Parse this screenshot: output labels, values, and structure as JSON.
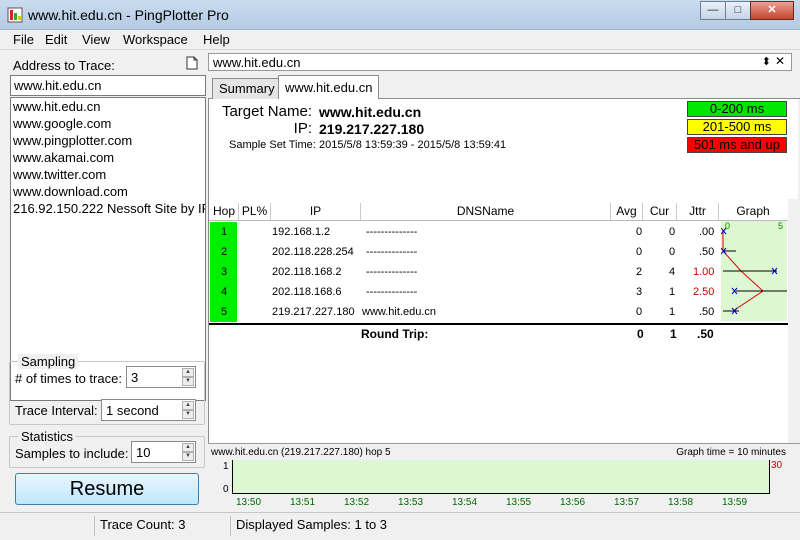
{
  "window": {
    "title": "www.hit.edu.cn - PingPlotter Pro",
    "min_symbol": "—",
    "max_symbol": "□",
    "close_symbol": "✕"
  },
  "menu": [
    "File",
    "Edit",
    "View",
    "Workspace",
    "Help"
  ],
  "left": {
    "address_label": "Address to Trace:",
    "address_value": "www.hit.edu.cn",
    "history": [
      "www.hit.edu.cn",
      "www.google.com",
      "www.pingplotter.com",
      "www.akamai.com",
      "www.twitter.com",
      "www.download.com",
      "216.92.150.222 Nessoft Site by IP"
    ],
    "sampling_title": "Sampling",
    "times_label": "# of times to trace:",
    "times_value": "3",
    "interval_label": "Trace Interval:",
    "interval_value": "1 second",
    "statistics_title": "Statistics",
    "samples_label": "Samples to include:",
    "samples_value": "10",
    "resume_label": "Resume"
  },
  "right": {
    "address_bar": "www.hit.edu.cn",
    "pin_symbol": "⬍",
    "close_symbol": "✕",
    "tabs": [
      "Summary",
      "www.hit.edu.cn"
    ],
    "target_name_label": "Target Name:",
    "target_name": "www.hit.edu.cn",
    "ip_label": "IP:",
    "ip": "219.217.227.180",
    "sample_set_label": "Sample Set Time:",
    "sample_set_value": "2015/5/8 13:59:39 - 2015/5/8 13:59:41",
    "legend": [
      {
        "label": "0-200 ms",
        "color": "#00e600"
      },
      {
        "label": "201-500 ms",
        "color": "#ffff00"
      },
      {
        "label": "501 ms and up",
        "color": "#ff0000"
      }
    ],
    "columns": [
      "Hop",
      "PL%",
      "IP",
      "DNSName",
      "Avg",
      "Cur",
      "Jttr",
      "Graph"
    ],
    "graph_scale_min": "0",
    "graph_scale_max": "5",
    "hops": [
      {
        "hop": "1",
        "ip": "192.168.1.2",
        "dns": "--------------",
        "avg": "0",
        "cur": "0",
        "jttr": ".00",
        "jttr_red": false
      },
      {
        "hop": "2",
        "ip": "202.118.228.254",
        "dns": "--------------",
        "avg": "0",
        "cur": "0",
        "jttr": ".50",
        "jttr_red": false
      },
      {
        "hop": "3",
        "ip": "202.118.168.2",
        "dns": "--------------",
        "avg": "2",
        "cur": "4",
        "jttr": "1.00",
        "jttr_red": true
      },
      {
        "hop": "4",
        "ip": "202.118.168.6",
        "dns": "--------------",
        "avg": "3",
        "cur": "1",
        "jttr": "2.50",
        "jttr_red": true
      },
      {
        "hop": "5",
        "ip": "219.217.227.180",
        "dns": "www.hit.edu.cn",
        "avg": "0",
        "cur": "1",
        "jttr": ".50",
        "jttr_red": false
      }
    ],
    "round_trip_label": "Round Trip:",
    "round_trip_avg": "0",
    "round_trip_cur": "1",
    "round_trip_jttr": ".50",
    "bottom_graph": {
      "title": "www.hit.edu.cn (219.217.227.180) hop 5",
      "graph_time": "Graph time = 10 minutes",
      "y_top": "1",
      "y_bottom": "0",
      "right_value": "30",
      "times": [
        "13:50",
        "13:51",
        "13:52",
        "13:53",
        "13:54",
        "13:55",
        "13:56",
        "13:57",
        "13:58",
        "13:59"
      ]
    }
  },
  "status": {
    "trace_count": "Trace Count: 3",
    "displayed": "Displayed Samples: 1 to 3"
  },
  "colors": {
    "hop_green": "#00ee00",
    "graph_bg": "#dcf7d2",
    "jitter_red": "#cc0000",
    "time_green": "#006600"
  }
}
